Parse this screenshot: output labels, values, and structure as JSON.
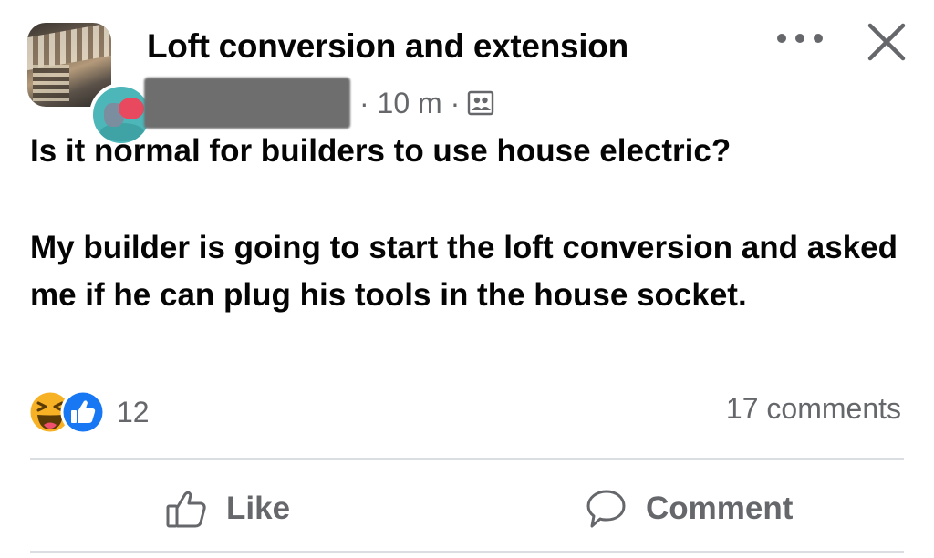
{
  "post": {
    "group_name": "Loft conversion and extension",
    "meta": "· 10 m ·",
    "audience_icon": "group-members-icon",
    "text_line1": "Is it normal for builders to use house electric?",
    "text_para2": "My builder is going to start the loft conversion and asked me if he can plug his tools in the house socket."
  },
  "reactions": {
    "icons": [
      "haha-reaction-icon",
      "like-reaction-icon"
    ],
    "count": "12",
    "comments": "17 comments"
  },
  "actions": {
    "like_label": "Like",
    "comment_label": "Comment"
  },
  "colors": {
    "primary_text": "#050505",
    "secondary_text": "#65676b",
    "like_blue": "#1877f2",
    "haha_yellow": "#f7b125",
    "divider": "#dadde1"
  }
}
